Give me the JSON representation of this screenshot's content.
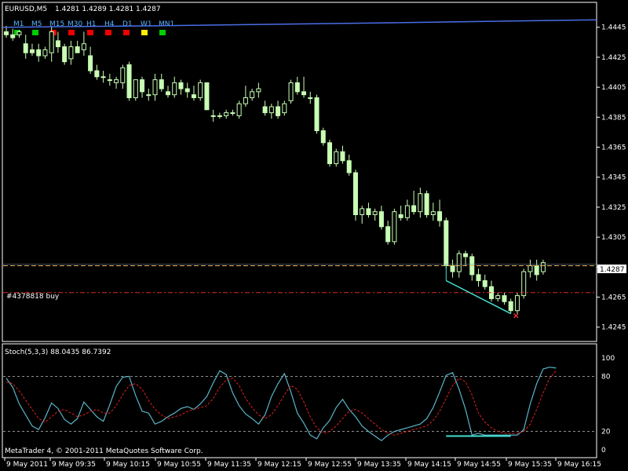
{
  "header": {
    "symbol": "EURUSD,M5",
    "ohlc": "1.4281 1.4289 1.4281 1.4287"
  },
  "timeframes": [
    {
      "label": "M1",
      "color": "#00cc00"
    },
    {
      "label": "M5",
      "color": "#00cc00"
    },
    {
      "label": "M15",
      "color": "#ee0000"
    },
    {
      "label": "M30",
      "color": "#ee0000"
    },
    {
      "label": "H1",
      "color": "#ee0000"
    },
    {
      "label": "H4",
      "color": "#ee0000"
    },
    {
      "label": "D1",
      "color": "#ee0000"
    },
    {
      "label": "W1",
      "color": "#ffee00"
    },
    {
      "label": "MN1",
      "color": "#00cc00"
    }
  ],
  "price_axis": {
    "labels": [
      "1.4445",
      "1.4425",
      "1.4405",
      "1.4385",
      "1.4365",
      "1.4345",
      "1.4325",
      "1.4305",
      "1.4285",
      "1.4265",
      "1.4245"
    ],
    "current_price": "1.4287"
  },
  "order_label": "#4378818 buy",
  "indicator": {
    "label": "Stoch(5,3,3) 88.0435 86.7392",
    "levels": [
      "100",
      "80",
      "20",
      "0"
    ]
  },
  "copyright": "MetaTrader 4, © 2001-2011 MetaQuotes Software Corp.",
  "time_axis": [
    "9 May 2011",
    "9 May 09:35",
    "9 May 10:15",
    "9 May 10:55",
    "9 May 11:35",
    "9 May 12:15",
    "9 May 12:55",
    "9 May 13:35",
    "9 May 14:15",
    "9 May 14:55",
    "9 May 15:35",
    "9 May 16:15"
  ],
  "colors": {
    "background": "#000000",
    "candle": "#c8ffb4",
    "stoch_main": "#5ab4c8",
    "stoch_signal": "#e02020",
    "divergence": "#40e0d0",
    "blue_line": "#4a6ee8",
    "order_line": "#e02828",
    "bid_line": "#e8b860"
  },
  "chart_data": {
    "type": "candlestick",
    "symbol": "EURUSD",
    "timeframe": "M5",
    "ylim": [
      1.4237,
      1.4459
    ],
    "current_price": 1.4287,
    "order_price": 1.4268,
    "upper_line": 1.445,
    "candles": [
      [
        1.4442,
        1.4446,
        1.4438,
        1.444
      ],
      [
        1.444,
        1.4444,
        1.4436,
        1.4438
      ],
      [
        1.444,
        1.4443,
        1.4438,
        1.4442
      ],
      [
        1.4434,
        1.444,
        1.4424,
        1.4428
      ],
      [
        1.443,
        1.4434,
        1.4426,
        1.4428
      ],
      [
        1.443,
        1.4434,
        1.4422,
        1.4426
      ],
      [
        1.4426,
        1.4432,
        1.4424,
        1.443
      ],
      [
        1.4428,
        1.4446,
        1.4422,
        1.4442
      ],
      [
        1.4436,
        1.4442,
        1.4428,
        1.4432
      ],
      [
        1.4432,
        1.4434,
        1.442,
        1.4422
      ],
      [
        1.4424,
        1.4436,
        1.442,
        1.4432
      ],
      [
        1.4432,
        1.4436,
        1.4428,
        1.4428
      ],
      [
        1.443,
        1.4442,
        1.4426,
        1.4434
      ],
      [
        1.4426,
        1.4432,
        1.4414,
        1.4416
      ],
      [
        1.4416,
        1.442,
        1.441,
        1.4412
      ],
      [
        1.4412,
        1.4416,
        1.4408,
        1.4412
      ],
      [
        1.441,
        1.4414,
        1.4406,
        1.441
      ],
      [
        1.4408,
        1.4412,
        1.4404,
        1.441
      ],
      [
        1.4408,
        1.442,
        1.4404,
        1.4418
      ],
      [
        1.442,
        1.4422,
        1.4396,
        1.4398
      ],
      [
        1.4398,
        1.441,
        1.4396,
        1.441
      ],
      [
        1.441,
        1.4412,
        1.4398,
        1.4402
      ],
      [
        1.44,
        1.4404,
        1.4396,
        1.44
      ],
      [
        1.44,
        1.4414,
        1.4396,
        1.441
      ],
      [
        1.441,
        1.4414,
        1.4402,
        1.4404
      ],
      [
        1.4402,
        1.4406,
        1.4398,
        1.44
      ],
      [
        1.44,
        1.4412,
        1.4398,
        1.4408
      ],
      [
        1.4408,
        1.441,
        1.44,
        1.4404
      ],
      [
        1.4404,
        1.4408,
        1.4398,
        1.4402
      ],
      [
        1.44,
        1.4406,
        1.4396,
        1.4398
      ],
      [
        1.4398,
        1.441,
        1.4396,
        1.4408
      ],
      [
        1.4408,
        1.4408,
        1.439,
        1.439
      ],
      [
        1.4386,
        1.439,
        1.4382,
        1.4386
      ],
      [
        1.4386,
        1.4388,
        1.4384,
        1.4386
      ],
      [
        1.4386,
        1.439,
        1.4384,
        1.4388
      ],
      [
        1.4388,
        1.439,
        1.4386,
        1.4388
      ],
      [
        1.4386,
        1.4396,
        1.4384,
        1.4394
      ],
      [
        1.4394,
        1.4406,
        1.4392,
        1.4398
      ],
      [
        1.4398,
        1.4404,
        1.4396,
        1.4402
      ],
      [
        1.4402,
        1.4408,
        1.4398,
        1.4404
      ],
      [
        1.4392,
        1.4396,
        1.4386,
        1.4388
      ],
      [
        1.4388,
        1.4394,
        1.4384,
        1.4392
      ],
      [
        1.4392,
        1.4396,
        1.4384,
        1.4386
      ],
      [
        1.4388,
        1.4396,
        1.4386,
        1.4394
      ],
      [
        1.4396,
        1.441,
        1.4394,
        1.4408
      ],
      [
        1.4408,
        1.4412,
        1.44,
        1.4402
      ],
      [
        1.4402,
        1.4412,
        1.4398,
        1.44
      ],
      [
        1.4398,
        1.4402,
        1.4394,
        1.4398
      ],
      [
        1.4398,
        1.44,
        1.4374,
        1.4376
      ],
      [
        1.4376,
        1.4378,
        1.4366,
        1.4368
      ],
      [
        1.4368,
        1.437,
        1.4352,
        1.4354
      ],
      [
        1.4354,
        1.4364,
        1.4352,
        1.4362
      ],
      [
        1.4362,
        1.4366,
        1.4354,
        1.4356
      ],
      [
        1.4356,
        1.436,
        1.4346,
        1.4348
      ],
      [
        1.4348,
        1.435,
        1.4316,
        1.432
      ],
      [
        1.432,
        1.4326,
        1.4314,
        1.4324
      ],
      [
        1.4324,
        1.4328,
        1.4318,
        1.432
      ],
      [
        1.432,
        1.4324,
        1.4316,
        1.4322
      ],
      [
        1.4322,
        1.4326,
        1.431,
        1.4312
      ],
      [
        1.4312,
        1.4316,
        1.43,
        1.4302
      ],
      [
        1.4302,
        1.4324,
        1.43,
        1.4322
      ],
      [
        1.432,
        1.4326,
        1.4316,
        1.4318
      ],
      [
        1.4318,
        1.433,
        1.4316,
        1.4326
      ],
      [
        1.4326,
        1.4336,
        1.432,
        1.4322
      ],
      [
        1.4322,
        1.4338,
        1.4318,
        1.4334
      ],
      [
        1.4334,
        1.4336,
        1.4318,
        1.432
      ],
      [
        1.432,
        1.4328,
        1.4316,
        1.4322
      ],
      [
        1.4322,
        1.433,
        1.4312,
        1.4316
      ],
      [
        1.4316,
        1.4318,
        1.4284,
        1.4286
      ],
      [
        1.4286,
        1.429,
        1.4278,
        1.4282
      ],
      [
        1.4282,
        1.4296,
        1.4278,
        1.4294
      ],
      [
        1.4294,
        1.4296,
        1.4286,
        1.4292
      ],
      [
        1.4292,
        1.4294,
        1.4276,
        1.428
      ],
      [
        1.428,
        1.4284,
        1.4272,
        1.4276
      ],
      [
        1.4276,
        1.428,
        1.427,
        1.4272
      ],
      [
        1.4272,
        1.4276,
        1.4262,
        1.4264
      ],
      [
        1.4264,
        1.4268,
        1.4262,
        1.4266
      ],
      [
        1.4266,
        1.4268,
        1.426,
        1.4262
      ],
      [
        1.4262,
        1.4264,
        1.4254,
        1.4256
      ],
      [
        1.4256,
        1.4268,
        1.4254,
        1.4266
      ],
      [
        1.4266,
        1.4284,
        1.4264,
        1.4282
      ],
      [
        1.4282,
        1.429,
        1.4278,
        1.4286
      ],
      [
        1.4286,
        1.429,
        1.4276,
        1.428
      ],
      [
        1.4282,
        1.429,
        1.428,
        1.4288
      ]
    ],
    "divergence_price": [
      [
        68,
        1.4276
      ],
      [
        78,
        1.4254
      ]
    ],
    "stochastic": {
      "main": [
        78,
        68,
        50,
        38,
        26,
        22,
        35,
        51,
        45,
        33,
        28,
        34,
        52,
        44,
        36,
        31,
        49,
        69,
        79,
        80,
        59,
        42,
        40,
        28,
        31,
        36,
        40,
        45,
        47,
        44,
        50,
        58,
        73,
        86,
        82,
        62,
        48,
        39,
        34,
        28,
        38,
        58,
        72,
        83,
        63,
        40,
        29,
        16,
        12,
        24,
        32,
        46,
        55,
        44,
        36,
        26,
        20,
        15,
        10,
        16,
        20,
        22,
        24,
        26,
        28,
        34,
        46,
        63,
        81,
        84,
        66,
        44,
        16,
        18,
        16,
        16,
        16,
        16,
        16,
        16,
        22,
        50,
        72,
        88,
        90,
        89
      ],
      "signal": [
        74,
        72,
        64,
        54,
        44,
        34,
        30,
        36,
        42,
        44,
        40,
        36,
        38,
        42,
        44,
        40,
        40,
        48,
        60,
        70,
        72,
        66,
        54,
        44,
        38,
        34,
        36,
        38,
        42,
        44,
        46,
        48,
        56,
        68,
        76,
        78,
        70,
        56,
        46,
        38,
        34,
        38,
        48,
        60,
        70,
        66,
        52,
        36,
        24,
        18,
        20,
        26,
        34,
        42,
        44,
        40,
        34,
        28,
        22,
        18,
        16,
        18,
        20,
        22,
        24,
        26,
        32,
        42,
        56,
        70,
        78,
        74,
        60,
        40,
        30,
        24,
        20,
        18,
        18,
        18,
        20,
        28,
        44,
        62,
        78,
        86
      ],
      "divergence": [
        [
          68,
          15
        ],
        [
          78,
          15
        ]
      ]
    }
  }
}
